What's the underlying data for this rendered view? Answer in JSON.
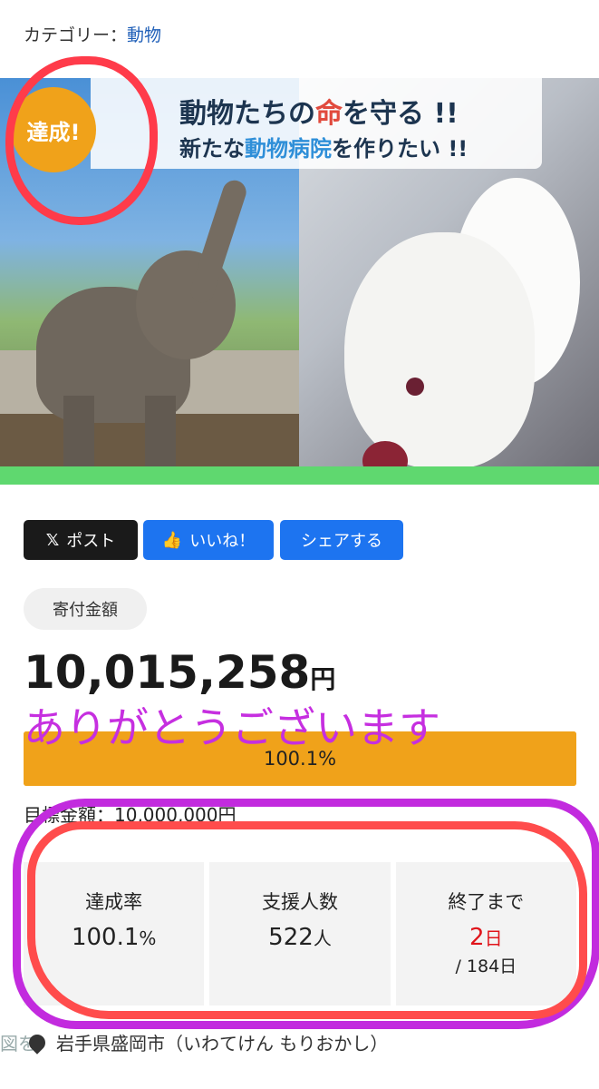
{
  "category": {
    "label": "カテゴリー：",
    "value": "動物"
  },
  "banner": {
    "line1_a": "動物たちの",
    "line1_b": "命",
    "line1_c": "を守る !!",
    "line2_a": "新たな",
    "line2_b": "動物病院",
    "line2_c": "を作りたい !!",
    "badge": "達成!"
  },
  "share": {
    "x_icon": "𝕏",
    "x_label": "ポスト",
    "like_icon": "👍",
    "like_label": "いいね！",
    "share_label": "シェアする"
  },
  "donation": {
    "tag": "寄付金額",
    "amount": "10,015,258",
    "currency": "円",
    "thanks": "ありがとうございます",
    "progress_percent": 100.1,
    "progress_label": "100.1%",
    "target_label": "目標金額：10,000,000円"
  },
  "stats": {
    "rate_label": "達成率",
    "rate_value": "100.1",
    "rate_unit": "%",
    "supporters_label": "支援人数",
    "supporters_value": "522",
    "supporters_unit": "人",
    "remaining_label": "終了まで",
    "remaining_value": "2",
    "remaining_unit": "日",
    "remaining_total": "/ 184日"
  },
  "location": {
    "map_hint": "図を",
    "text": "岩手県盛岡市（いわてけん もりおかし）"
  },
  "colors": {
    "accent": "#f0a21a",
    "button_blue": "#1d74f0",
    "annotation_red": "#ff3b4a",
    "annotation_purple": "#c62fe0"
  }
}
